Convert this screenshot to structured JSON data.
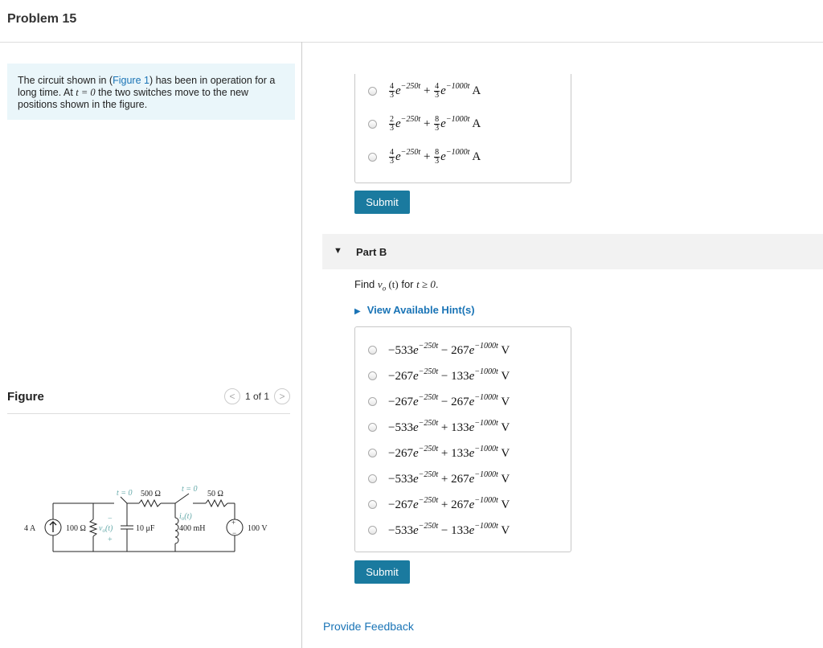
{
  "problem_title": "Problem 15",
  "intro": {
    "part1": "The circuit shown in (",
    "figure_link": "Figure 1",
    "part2": ") has been in operation for a long time. At ",
    "t_eq": "t = 0",
    "part3": " the two switches move to the new positions shown in the figure."
  },
  "figure": {
    "label": "Figure",
    "pager": "1 of 1",
    "prev_icon": "<",
    "next_icon": ">",
    "circuit_labels": {
      "source_current": "4 A",
      "r100": "100 Ω",
      "vo": "v",
      "vo_sub": "o",
      "vo_arg": "(t)",
      "cap": "10 μF",
      "switch1": "t = 0",
      "r500": "500 Ω",
      "switch2": "t = 0",
      "io": "i",
      "io_sub": "o",
      "io_arg": "(t)",
      "inductor": "400 mH",
      "r50": "50 Ω",
      "source_voltage": "100 V",
      "minus": "−",
      "plus": "+"
    }
  },
  "part_a": {
    "options": [
      {
        "c1n": "4",
        "c1d": "3",
        "e1": "−250t",
        "c2n": "4",
        "c2d": "3",
        "e2": "−1000t",
        "unit": "A"
      },
      {
        "c1n": "2",
        "c1d": "3",
        "e1": "−250t",
        "c2n": "8",
        "c2d": "3",
        "e2": "−1000t",
        "unit": "A"
      },
      {
        "c1n": "4",
        "c1d": "3",
        "e1": "−250t",
        "c2n": "8",
        "c2d": "3",
        "e2": "−1000t",
        "unit": "A"
      }
    ],
    "submit_label": "Submit"
  },
  "part_b": {
    "label": "Part B",
    "prompt_prefix": "Find ",
    "prompt_var": "v",
    "prompt_sub": "o",
    "prompt_arg": " (t)",
    "prompt_mid": " for ",
    "prompt_cond": "t ≥ 0",
    "prompt_end": ".",
    "hints_label": "View Available Hint(s)",
    "options": [
      {
        "a": "−533",
        "e1": "−250t",
        "op": "−",
        "b": "267",
        "e2": "−1000t",
        "unit": "V"
      },
      {
        "a": "−267",
        "e1": "−250t",
        "op": "−",
        "b": "133",
        "e2": "−1000t",
        "unit": "V"
      },
      {
        "a": "−267",
        "e1": "−250t",
        "op": "−",
        "b": "267",
        "e2": "−1000t",
        "unit": "V"
      },
      {
        "a": "−533",
        "e1": "−250t",
        "op": "+",
        "b": "133",
        "e2": "−1000t",
        "unit": "V"
      },
      {
        "a": "−267",
        "e1": "−250t",
        "op": "+",
        "b": "133",
        "e2": "−1000t",
        "unit": "V"
      },
      {
        "a": "−533",
        "e1": "−250t",
        "op": "+",
        "b": "267",
        "e2": "−1000t",
        "unit": "V"
      },
      {
        "a": "−267",
        "e1": "−250t",
        "op": "+",
        "b": "267",
        "e2": "−1000t",
        "unit": "V"
      },
      {
        "a": "−533",
        "e1": "−250t",
        "op": "−",
        "b": "133",
        "e2": "−1000t",
        "unit": "V"
      }
    ],
    "submit_label": "Submit"
  },
  "feedback_label": "Provide Feedback"
}
